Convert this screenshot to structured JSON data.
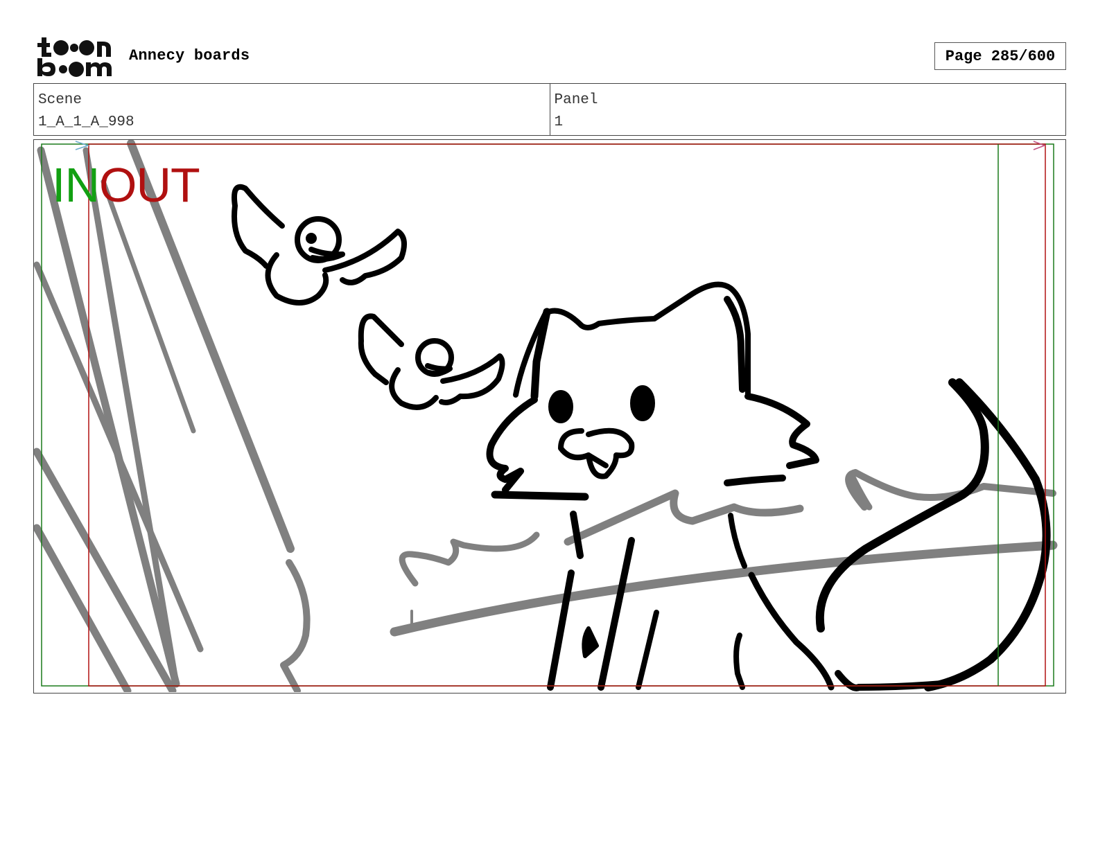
{
  "header": {
    "logo_text": "toon boom",
    "project_title": "Annecy boards",
    "page_indicator": "Page 285/600"
  },
  "info": {
    "scene_label": "Scene",
    "scene_value": "1_A_1_A_998",
    "panel_label": "Panel",
    "panel_value": "1"
  },
  "panel": {
    "in_marker": "IN",
    "out_marker": "OUT",
    "colors": {
      "in_line": "#1a7a1a",
      "out_line": "#b01010",
      "sketch_black": "#000000",
      "sketch_gray": "#808080"
    }
  }
}
